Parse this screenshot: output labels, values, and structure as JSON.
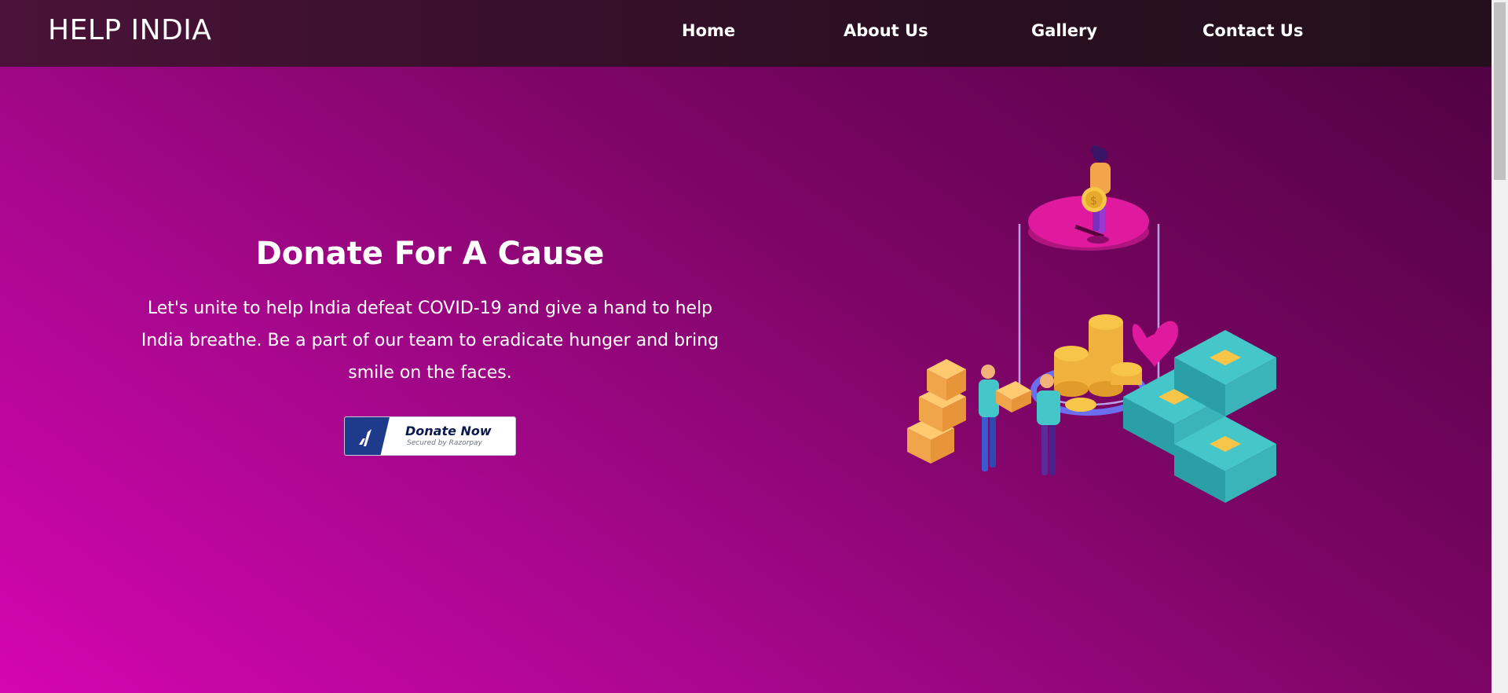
{
  "navbar": {
    "brand": "HELP INDIA",
    "links": [
      "Home",
      "About Us",
      "Gallery",
      "Contact Us"
    ]
  },
  "hero": {
    "title": "Donate For A Cause",
    "text": "Let's unite to help India defeat COVID-19 and give a hand to help India breathe. Be a part of our team to eradicate hunger and bring smile on the faces.",
    "donate_button": {
      "label": "Donate Now",
      "sublabel": "Secured by Razorpay"
    },
    "illustration_icon": "donation-jar-illustration"
  },
  "colors": {
    "navbar": "#2b0f22",
    "hero_gradient_start": "#d406b0",
    "hero_gradient_end": "#4d0240",
    "button_logo": "#1e3a8a"
  }
}
